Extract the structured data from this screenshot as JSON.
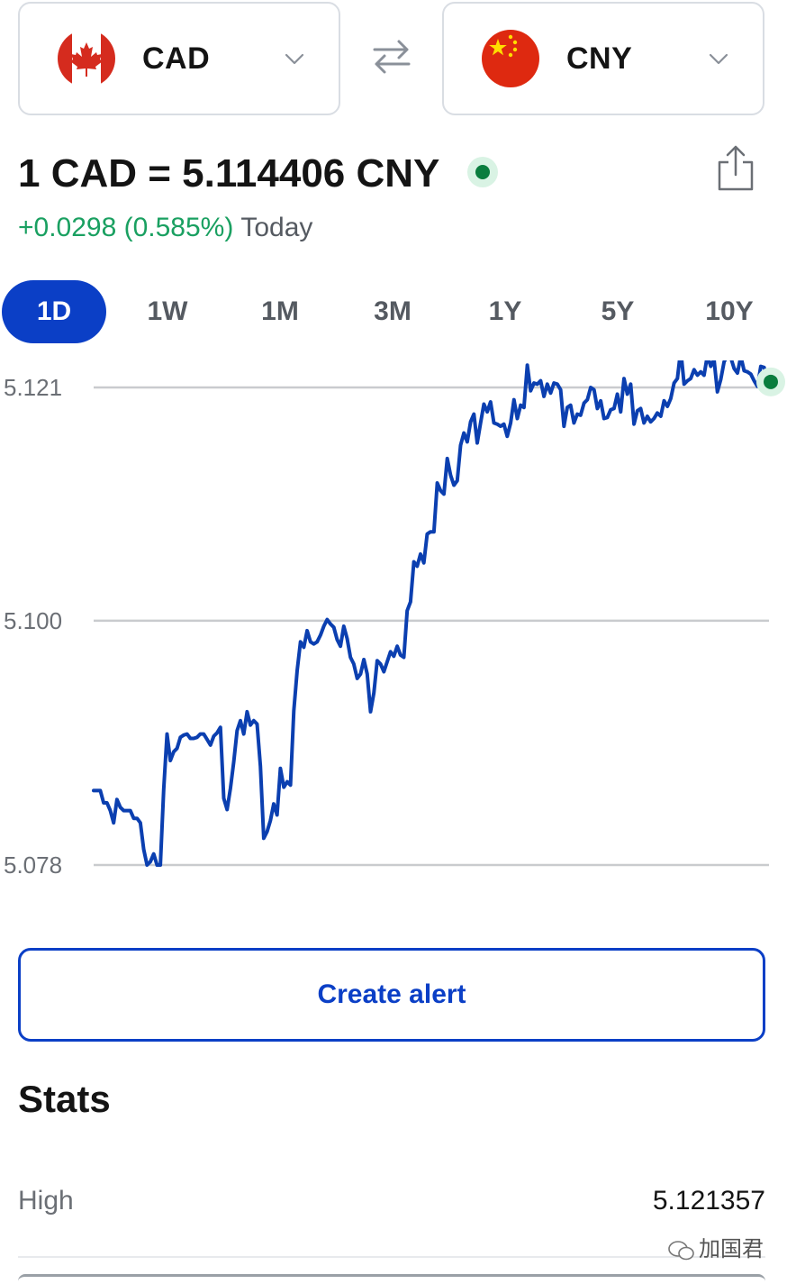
{
  "from_currency": {
    "code": "CAD",
    "flag_icon": "canada-flag-icon"
  },
  "to_currency": {
    "code": "CNY",
    "flag_icon": "china-flag-icon"
  },
  "rate": {
    "text": "1 CAD = 5.114406 CNY"
  },
  "change": {
    "delta": "+0.0298 (0.585%)",
    "period": "Today"
  },
  "ranges": [
    {
      "label": "1D",
      "active": true
    },
    {
      "label": "1W",
      "active": false
    },
    {
      "label": "1M",
      "active": false
    },
    {
      "label": "3M",
      "active": false
    },
    {
      "label": "1Y",
      "active": false
    },
    {
      "label": "5Y",
      "active": false
    },
    {
      "label": "10Y",
      "active": false
    }
  ],
  "chart_data": {
    "type": "line",
    "title": "",
    "xlabel": "",
    "ylabel": "",
    "y_ticks": [
      "5.121",
      "5.100",
      "5.078"
    ],
    "ylim": [
      5.078,
      5.121
    ],
    "grid": true,
    "line_color": "#0b3fb0",
    "series": [
      {
        "values": [
          5.0847,
          5.0847,
          5.0847,
          5.0836,
          5.0836,
          5.0829,
          5.0818,
          5.0839,
          5.0832,
          5.0829,
          5.0829,
          5.0829,
          5.0822,
          5.0822,
          5.0818,
          5.0794,
          5.078,
          5.0783,
          5.079,
          5.078,
          5.078,
          5.0848,
          5.0898,
          5.0874,
          5.0882,
          5.0885,
          5.0895,
          5.0897,
          5.0898,
          5.0894,
          5.0894,
          5.0895,
          5.0898,
          5.0898,
          5.0893,
          5.0888,
          5.0896,
          5.0899,
          5.0904,
          5.084,
          5.083,
          5.0849,
          5.0873,
          5.0901,
          5.091,
          5.0898,
          5.0918,
          5.0906,
          5.091,
          5.0907,
          5.0869,
          5.0804,
          5.081,
          5.082,
          5.0835,
          5.0825,
          5.0867,
          5.085,
          5.0855,
          5.0852,
          5.0919,
          5.0955,
          5.0981,
          5.0976,
          5.0991,
          5.0981,
          5.0979,
          5.0981,
          5.0987,
          5.0995,
          5.1001,
          5.0997,
          5.0994,
          5.0983,
          5.0977,
          5.0995,
          5.0984,
          5.0967,
          5.0961,
          5.0948,
          5.0952,
          5.0965,
          5.0952,
          5.0918,
          5.0935,
          5.0964,
          5.0961,
          5.0954,
          5.0963,
          5.0972,
          5.0968,
          5.0977,
          5.0969,
          5.0967,
          5.1009,
          5.1017,
          5.1053,
          5.1049,
          5.106,
          5.1052,
          5.1078,
          5.108,
          5.108,
          5.1124,
          5.1117,
          5.1114,
          5.1146,
          5.1131,
          5.1122,
          5.1126,
          5.1158,
          5.1169,
          5.1161,
          5.1179,
          5.1186,
          5.116,
          5.1178,
          5.1195,
          5.1188,
          5.1197,
          5.1178,
          5.1177,
          5.1175,
          5.1177,
          5.1166,
          5.1178,
          5.1199,
          5.1182,
          5.1194,
          5.1192,
          5.123,
          5.1207,
          5.1214,
          5.1213,
          5.1216,
          5.1202,
          5.1213,
          5.1205,
          5.1214,
          5.1213,
          5.1208,
          5.1175,
          5.1192,
          5.1194,
          5.1178,
          5.1186,
          5.1185,
          5.1196,
          5.1199,
          5.121,
          5.1208,
          5.1191,
          5.1198,
          5.1182,
          5.1183,
          5.119,
          5.1191,
          5.1204,
          5.1188,
          5.1218,
          5.1204,
          5.1213,
          5.1177,
          5.1189,
          5.1191,
          5.1178,
          5.1184,
          5.1179,
          5.1182,
          5.1187,
          5.1184,
          5.1198,
          5.1193,
          5.12,
          5.1214,
          5.1218,
          5.1244,
          5.1213,
          5.1216,
          5.1218,
          5.1226,
          5.1221,
          5.1224,
          5.1221,
          5.1239,
          5.1229,
          5.1235,
          5.1206,
          5.1217,
          5.1233,
          5.1239,
          5.1237,
          5.1227,
          5.1223,
          5.1238,
          5.1225,
          5.1224,
          5.1222,
          5.1216,
          5.1211,
          5.1229,
          5.1228,
          5.1214,
          5.1215
        ]
      }
    ]
  },
  "alert_button": {
    "label": "Create alert"
  },
  "stats": {
    "title": "Stats",
    "rows": [
      {
        "label": "High",
        "value": "5.121357"
      }
    ]
  },
  "watermark": {
    "text": "加国君"
  }
}
